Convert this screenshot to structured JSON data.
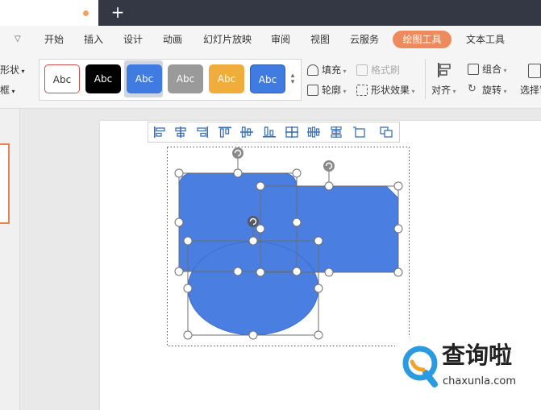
{
  "menubar": {
    "items": [
      "开始",
      "插入",
      "设计",
      "动画",
      "幻灯片放映",
      "审阅",
      "视图",
      "云服务",
      "绘图工具",
      "文本工具"
    ],
    "active": "绘图工具"
  },
  "ribbon": {
    "left_partial": [
      "形状",
      "框"
    ],
    "style_swatches": [
      "Abc",
      "Abc",
      "Abc",
      "Abc",
      "Abc",
      "Abc"
    ],
    "fill_label": "填充",
    "format_brush_label": "格式刷",
    "outline_label": "轮廓",
    "shape_effect_label": "形状效果",
    "align_label": "对齐",
    "group_label": "组合",
    "rotate_label": "旋转",
    "select_pane_label": "选择窗"
  },
  "colors": {
    "shape_fill": "#4a7ee0",
    "shape_stroke": "#3f6ec4",
    "accent_orange": "#ef8a5c",
    "title_dark": "#343744"
  },
  "watermark": {
    "title": "查询啦",
    "url": "chaxunla.com"
  }
}
